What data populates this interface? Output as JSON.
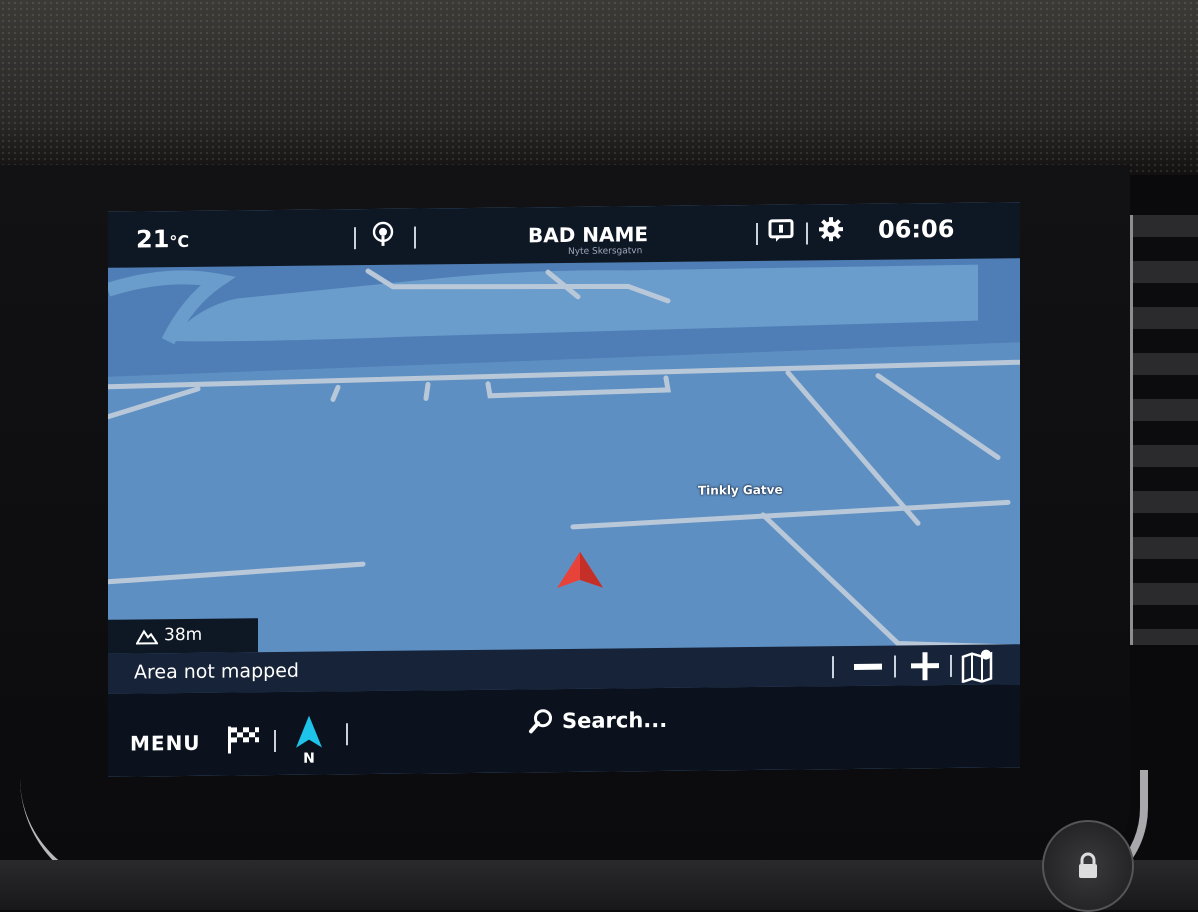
{
  "header": {
    "temperature": "21",
    "temperature_unit": "°C",
    "route_name": "BAD NAME",
    "route_subtitle": "Nyte Skersgatvn",
    "clock": "06:06"
  },
  "map": {
    "street_label": "Tinkly Gatve",
    "water_color": "#4f7db5",
    "land_color": "#5e8fc2",
    "vehicle_color": "#e8433a"
  },
  "altitude": {
    "value": "38m"
  },
  "status": {
    "message": "Area not mapped"
  },
  "bottom_bar": {
    "menu_label": "MENU",
    "search_label": "Search...",
    "compass_label": "N"
  },
  "icons": {
    "radio": "radio-icon",
    "message": "message-icon",
    "settings": "gear-icon",
    "destination": "checkered-flag-icon",
    "compass": "north-arrow-icon",
    "search": "search-icon",
    "zoom_out": "minus-icon",
    "zoom_in": "plus-icon",
    "map_options": "map-options-icon",
    "altitude": "mountain-icon",
    "lock": "lock-icon"
  }
}
